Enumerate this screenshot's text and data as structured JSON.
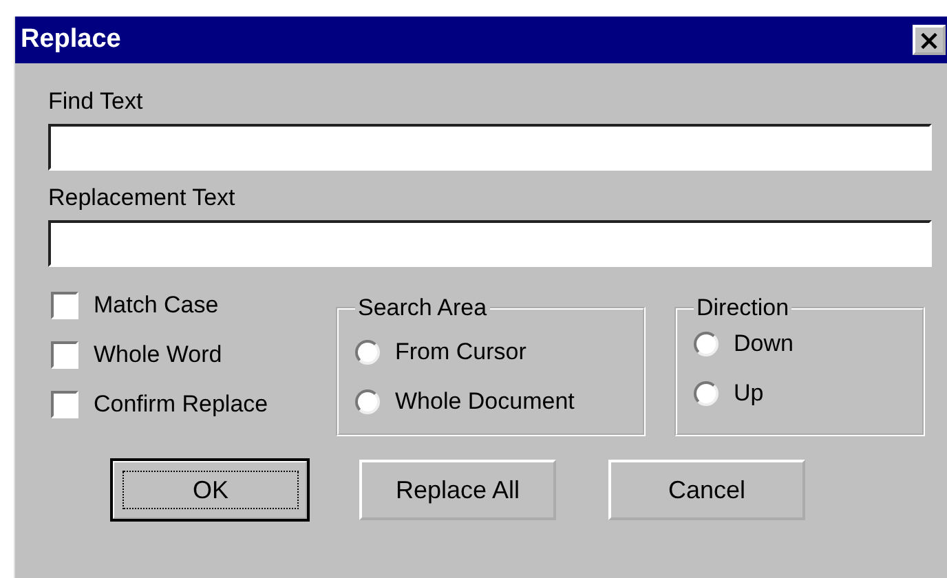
{
  "window": {
    "title": "Replace",
    "close": "×"
  },
  "fields": [
    {
      "label": "Find Text"
    },
    {
      "label": "Replacement Text"
    }
  ],
  "options": [
    {
      "label": "Match Case",
      "checked": false
    },
    {
      "label": "Whole Word",
      "checked": false
    },
    {
      "label": "Confirm Replace",
      "checked": false
    }
  ],
  "groups": [
    {
      "title": "Search Area",
      "items": [
        {
          "label": "From Cursor",
          "selected": false
        },
        {
          "label": "Whole Document",
          "selected": false
        }
      ]
    },
    {
      "title": "Direction",
      "items": [
        {
          "label": "Down",
          "selected": false
        },
        {
          "label": "Up",
          "selected": false
        }
      ]
    }
  ],
  "buttons": [
    {
      "label": "OK",
      "focused": true
    },
    {
      "label": "Replace All",
      "focused": false
    },
    {
      "label": "Cancel",
      "focused": false
    }
  ]
}
